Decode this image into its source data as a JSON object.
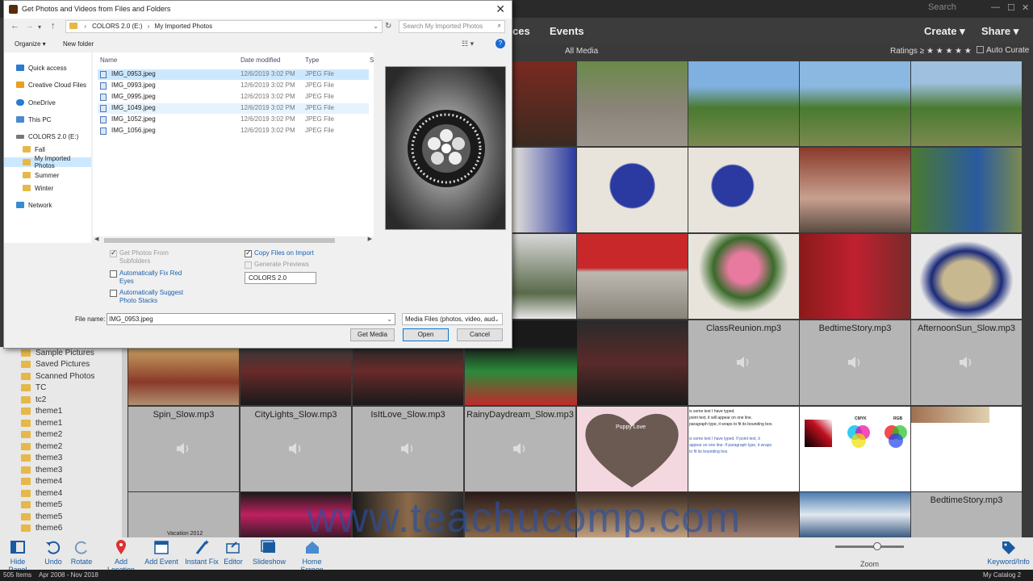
{
  "organizer": {
    "search_label": "Search",
    "menu": [
      "ces",
      "Events",
      "Create",
      "Share"
    ],
    "all_media": "All Media",
    "ratings_label": "Ratings ≥ ★ ★ ★ ★ ★",
    "auto_curate": "Auto Curate",
    "left_items": [
      "Sample Pictures",
      "Saved Pictures",
      "Scanned Photos",
      "TC",
      "tc2",
      "theme1",
      "theme1",
      "theme2",
      "theme2",
      "theme3",
      "theme3",
      "theme4",
      "theme4",
      "theme5",
      "theme5",
      "theme6"
    ],
    "audio_files": [
      "ClassReunion.mp3",
      "BedtimeStory.mp3",
      "AfternoonSun_Slow.mp3",
      "Spin_Slow.mp3",
      "CityLights_Slow.mp3",
      "IsItLove_Slow.mp3",
      "RainyDaydream_Slow.mp3",
      "BedtimeStory.mp3"
    ],
    "vacation_label": "Vacation 2012",
    "puppy_label": "Puppy Love",
    "text_sample": [
      "is some text I have typed.",
      "point text, it will appear on one line.",
      "paragraph type, it wraps to fit its bounding box.",
      "is some text I have typed. If point text, it",
      "appear on one line. If paragraph type, it wraps",
      "to fit its bounding box."
    ],
    "cmyk": "CMYK",
    "rgb": "RGB",
    "toolbar": [
      "Hide Panel",
      "Undo",
      "Rotate",
      "Add Location",
      "Add Event",
      "Instant Fix",
      "Editor",
      "Slideshow",
      "Home Screen"
    ],
    "zoom_label": "Zoom",
    "keyword_label": "Keyword/Info",
    "status": {
      "items": "505 Items",
      "range": "Apr 2008 - Nov 2018",
      "catalog": "My Catalog 2"
    },
    "watermark": "www.teachucomp.com"
  },
  "dialog": {
    "title": "Get Photos and Videos from Files and Folders",
    "address": [
      "COLORS 2.0 (E:)",
      "My Imported Photos"
    ],
    "search_placeholder": "Search My Imported Photos",
    "organize": "Organize ▾",
    "new_folder": "New folder",
    "nav": [
      "Quick access",
      "Creative Cloud Files",
      "OneDrive",
      "This PC",
      "COLORS 2.0 (E:)",
      "Fall",
      "My Imported Photos",
      "Summer",
      "Winter",
      "Network"
    ],
    "columns": [
      "Name",
      "Date modified",
      "Type",
      "S"
    ],
    "files": [
      {
        "name": "IMG_0953.jpeg",
        "date": "12/6/2019 3:02 PM",
        "type": "JPEG File"
      },
      {
        "name": "IMG_0993.jpeg",
        "date": "12/6/2019 3:02 PM",
        "type": "JPEG File"
      },
      {
        "name": "IMG_0995.jpeg",
        "date": "12/6/2019 3:02 PM",
        "type": "JPEG File"
      },
      {
        "name": "IMG_1049.jpeg",
        "date": "12/6/2019 3:02 PM",
        "type": "JPEG File"
      },
      {
        "name": "IMG_1052.jpeg",
        "date": "12/6/2019 3:02 PM",
        "type": "JPEG File"
      },
      {
        "name": "IMG_1056.jpeg",
        "date": "12/6/2019 3:02 PM",
        "type": "JPEG File"
      }
    ],
    "opt_subfolders": "Get Photos From Subfolders",
    "opt_redeye": "Automatically Fix Red Eyes",
    "opt_stacks": "Automatically Suggest Photo Stacks",
    "opt_copy": "Copy Files on Import",
    "opt_previews": "Generate Previews",
    "dest_value": "COLORS 2.0",
    "file_name_label": "File name:",
    "file_name_value": "IMG_0953.jpeg",
    "file_type": "Media Files (photos, video, aud",
    "btn_get": "Get Media",
    "btn_open": "Open",
    "btn_cancel": "Cancel"
  }
}
